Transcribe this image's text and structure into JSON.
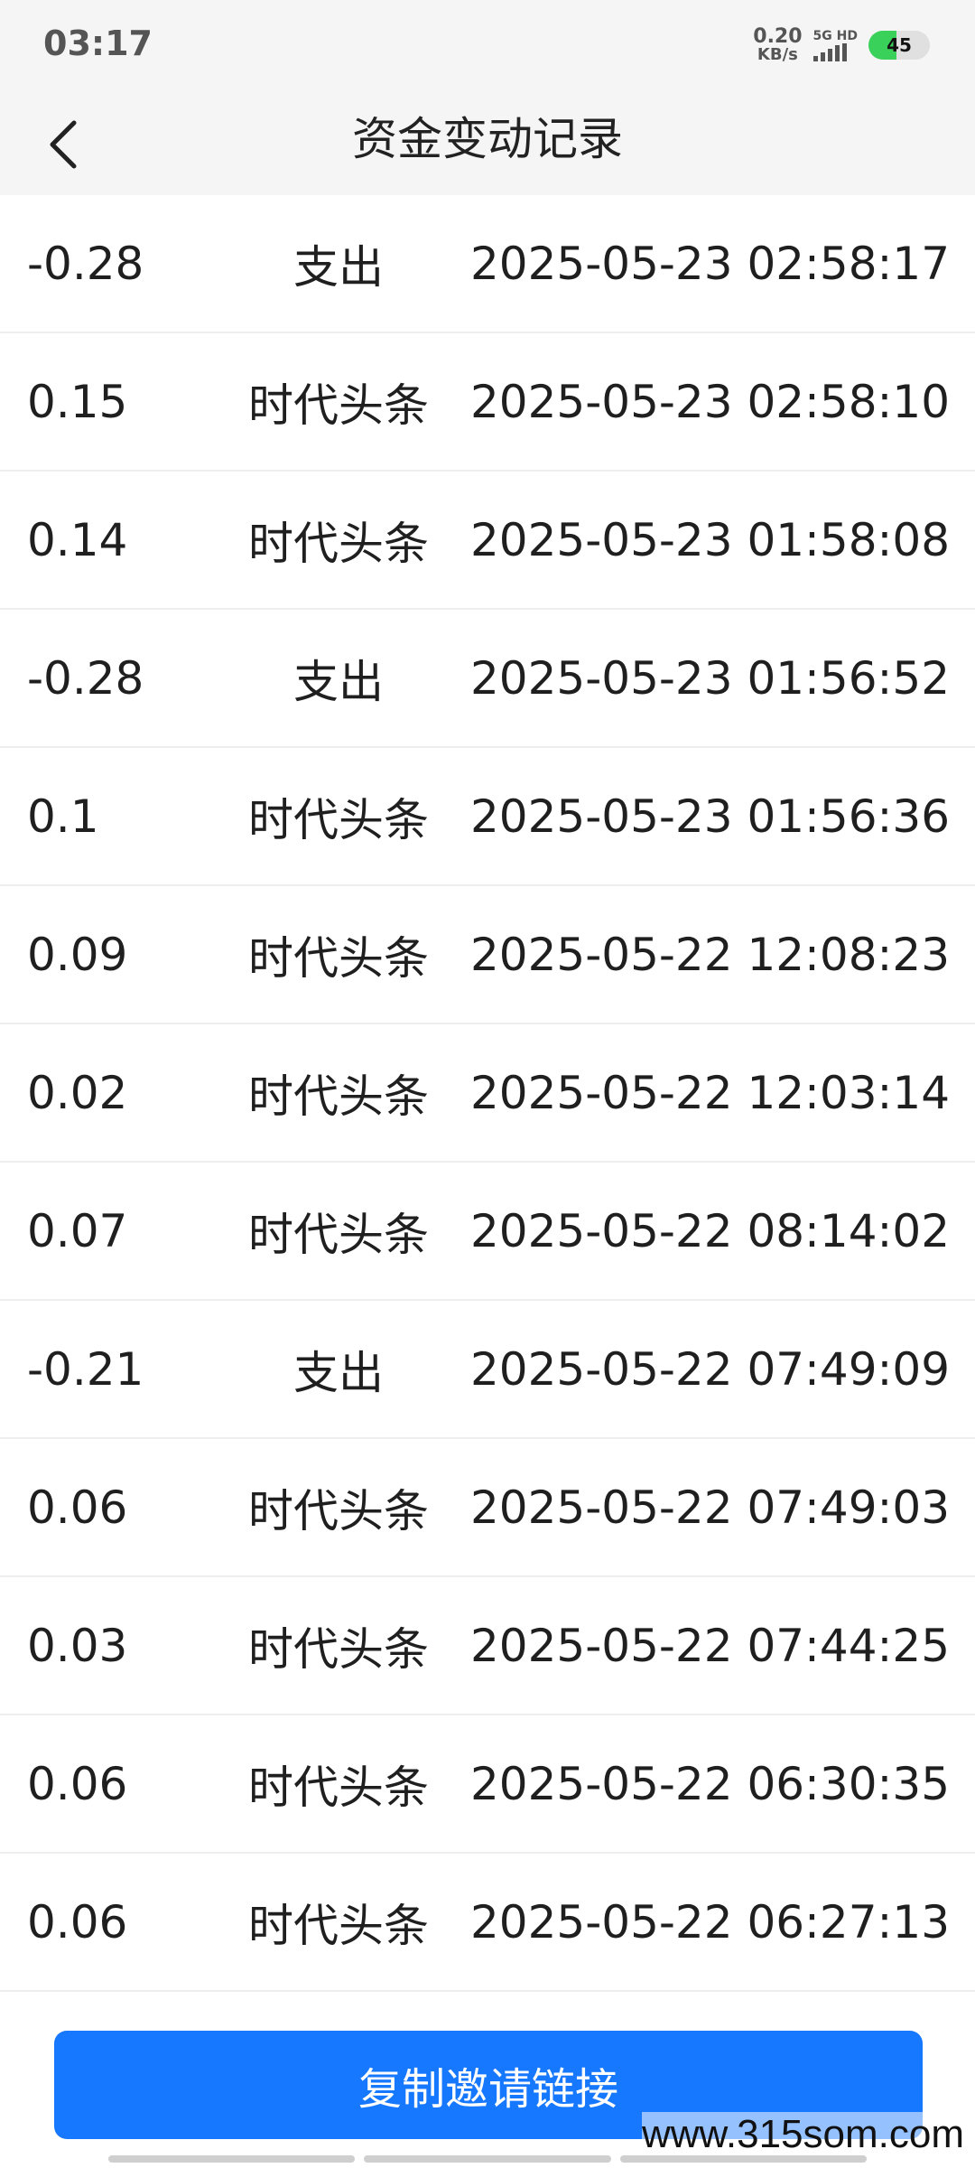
{
  "status_bar": {
    "time": "03:17",
    "net_speed_value": "0.20",
    "net_speed_unit": "KB/s",
    "signal_label": "5G HD",
    "battery": "45",
    "battery_color": "#3ad15a"
  },
  "header": {
    "title": "资金变动记录",
    "back_icon": "chevron-left-icon"
  },
  "records": [
    {
      "amount": "-0.28",
      "type": "支出",
      "time": "2025-05-23 02:58:17"
    },
    {
      "amount": "0.15",
      "type": "时代头条",
      "time": "2025-05-23 02:58:10"
    },
    {
      "amount": "0.14",
      "type": "时代头条",
      "time": "2025-05-23 01:58:08"
    },
    {
      "amount": "-0.28",
      "type": "支出",
      "time": "2025-05-23 01:56:52"
    },
    {
      "amount": "0.1",
      "type": "时代头条",
      "time": "2025-05-23 01:56:36"
    },
    {
      "amount": "0.09",
      "type": "时代头条",
      "time": "2025-05-22 12:08:23"
    },
    {
      "amount": "0.02",
      "type": "时代头条",
      "time": "2025-05-22 12:03:14"
    },
    {
      "amount": "0.07",
      "type": "时代头条",
      "time": "2025-05-22 08:14:02"
    },
    {
      "amount": "-0.21",
      "type": "支出",
      "time": "2025-05-22 07:49:09"
    },
    {
      "amount": "0.06",
      "type": "时代头条",
      "time": "2025-05-22 07:49:03"
    },
    {
      "amount": "0.03",
      "type": "时代头条",
      "time": "2025-05-22 07:44:25"
    },
    {
      "amount": "0.06",
      "type": "时代头条",
      "time": "2025-05-22 06:30:35"
    },
    {
      "amount": "0.06",
      "type": "时代头条",
      "time": "2025-05-22 06:27:13"
    }
  ],
  "footer": {
    "copy_button_label": "复制邀请链接",
    "button_color": "#1677ff",
    "watermark": "www.315som.com"
  }
}
